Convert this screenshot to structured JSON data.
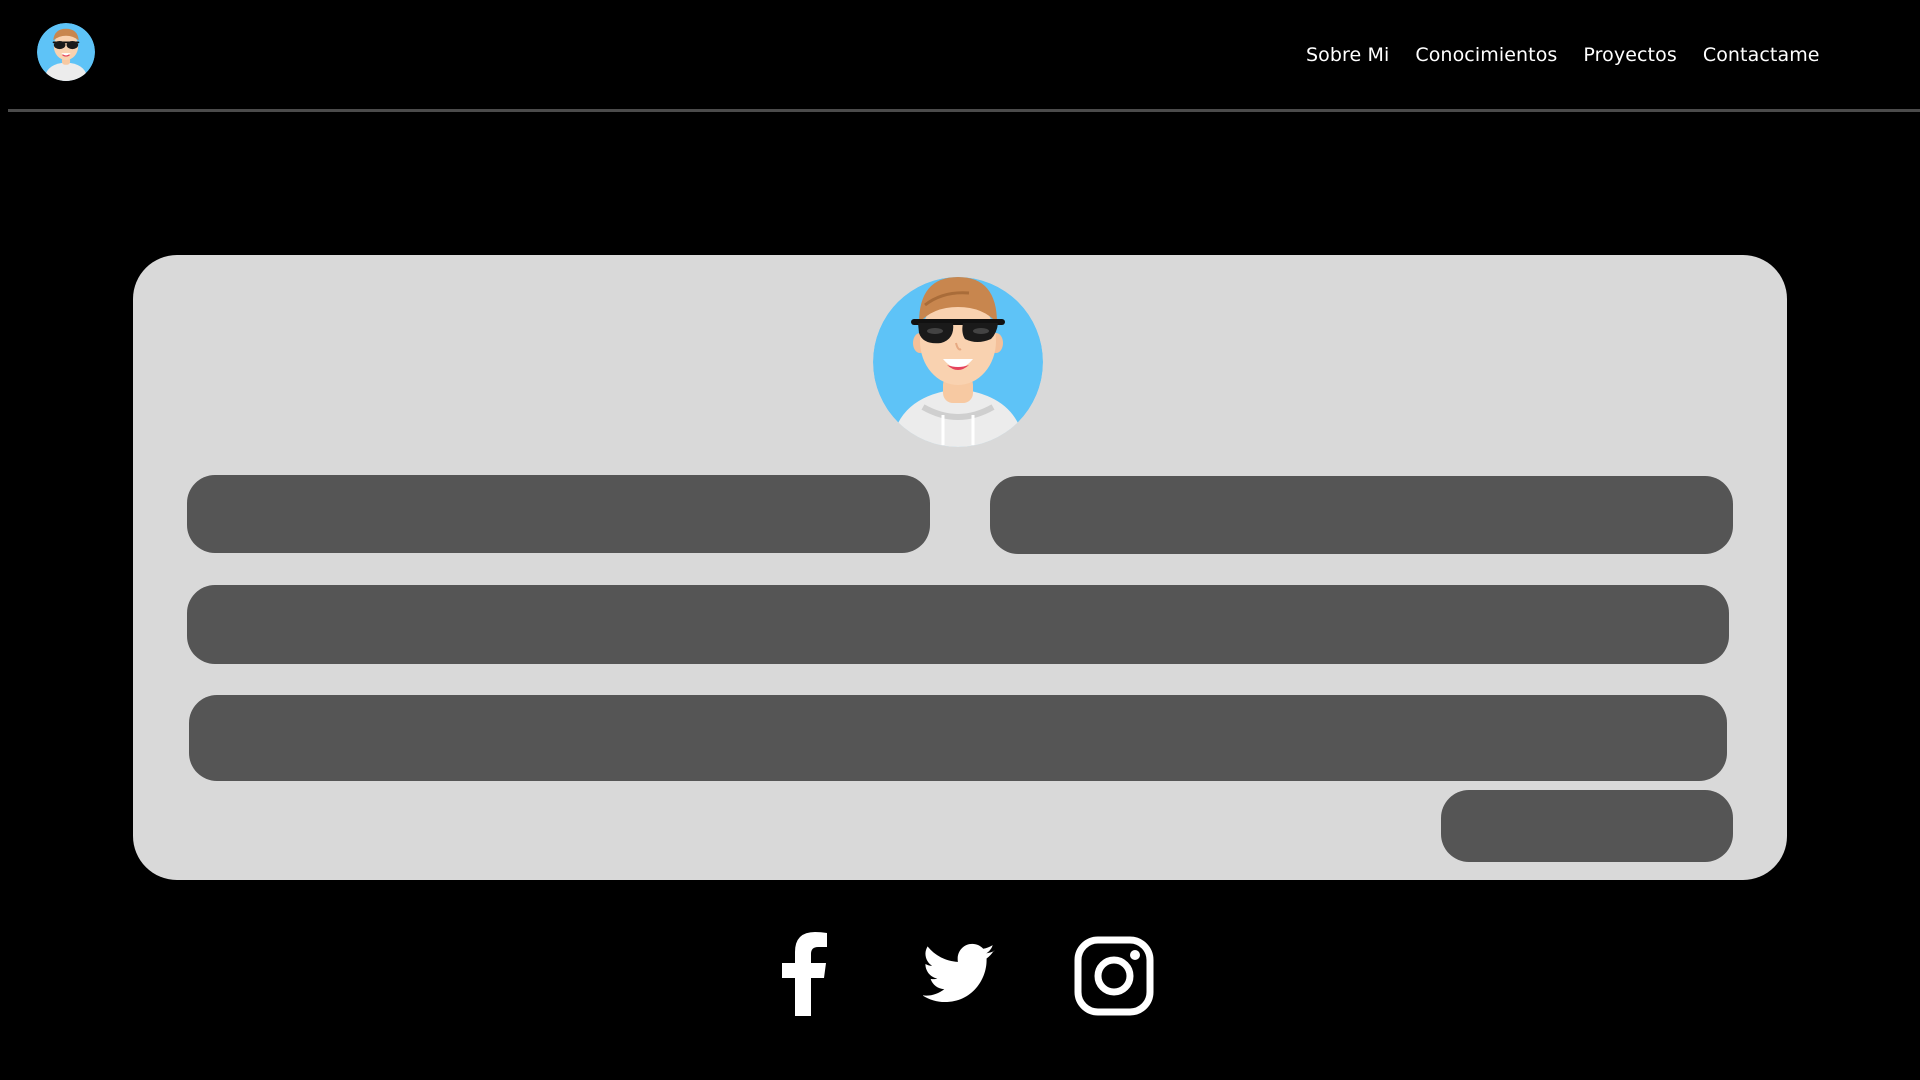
{
  "header": {
    "logo_icon": "memoji-avatar-icon",
    "nav": [
      {
        "label": "Sobre Mi"
      },
      {
        "label": "Conocimientos"
      },
      {
        "label": "Proyectos"
      },
      {
        "label": "Contactame"
      }
    ]
  },
  "contact_form": {
    "avatar_icon": "memoji-avatar-icon",
    "fields": {
      "name": {
        "value": "",
        "placeholder": ""
      },
      "email": {
        "value": "",
        "placeholder": ""
      },
      "subject": {
        "value": "",
        "placeholder": ""
      },
      "message": {
        "value": "",
        "placeholder": ""
      }
    },
    "send_label": ""
  },
  "social": [
    {
      "icon": "facebook-icon"
    },
    {
      "icon": "twitter-icon"
    },
    {
      "icon": "instagram-icon"
    }
  ],
  "colors": {
    "background": "#000000",
    "card": "#d9d9d9",
    "field": "#555555",
    "divider": "#4b4b4b",
    "text": "#ffffff",
    "avatar_bg": "#5ec3f7"
  }
}
